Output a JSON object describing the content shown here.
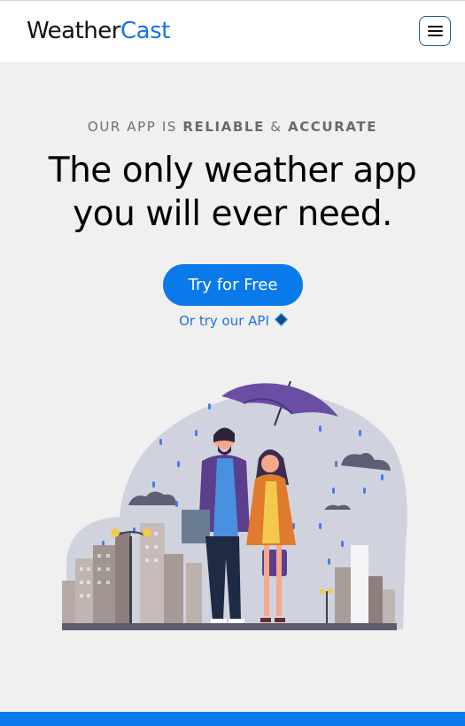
{
  "header": {
    "logo_part1": "Weather",
    "logo_part2": "Cast",
    "menu_icon": "hamburger-menu-icon"
  },
  "hero": {
    "kicker_prefix": "OUR APP IS ",
    "kicker_word1": "RELIABLE",
    "kicker_amp": " & ",
    "kicker_word2": "ACCURATE",
    "headline_line1": "The only weather app",
    "headline_line2": "you will ever need.",
    "cta_label": "Try for Free",
    "api_link_label": "Or try our API",
    "api_icon": "diamond-icon"
  },
  "illustration": {
    "icon": "couple-under-umbrella-city-rain-illustration"
  },
  "colors": {
    "brand_blue": "#0a7aea",
    "logo_accent": "#1a73e8",
    "background": "#f0f0f0"
  }
}
